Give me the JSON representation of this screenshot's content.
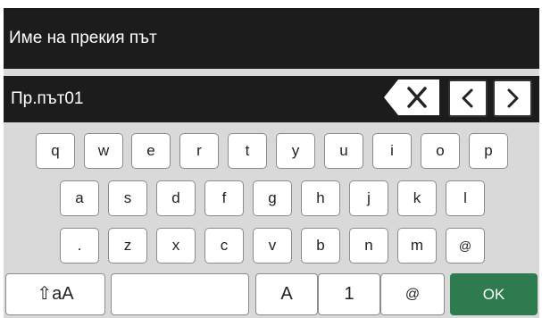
{
  "header": {
    "title": "Име на прекия път"
  },
  "input": {
    "value": "Пр.път01"
  },
  "controls": {
    "backspace_icon": "backspace-x-icon",
    "cursor_left_icon": "chevron-left-icon",
    "cursor_right_icon": "chevron-right-icon"
  },
  "keyboard": {
    "row1": [
      "q",
      "w",
      "e",
      "r",
      "t",
      "y",
      "u",
      "i",
      "o",
      "p"
    ],
    "row2": [
      "a",
      "s",
      "d",
      "f",
      "g",
      "h",
      "j",
      "k",
      "l"
    ],
    "row3": [
      ".",
      "z",
      "x",
      "c",
      "v",
      "b",
      "n",
      "m",
      "@"
    ],
    "bottom": {
      "shift_label": "⇧aA",
      "space_label": "",
      "alpha_label": "A",
      "numeric_label": "1",
      "symbol_label": "@",
      "ok_label": "OK"
    }
  },
  "colors": {
    "bar_bg": "#1c1c1c",
    "keyboard_bg": "#d9d9d9",
    "ok_green": "#2d7b4e"
  }
}
